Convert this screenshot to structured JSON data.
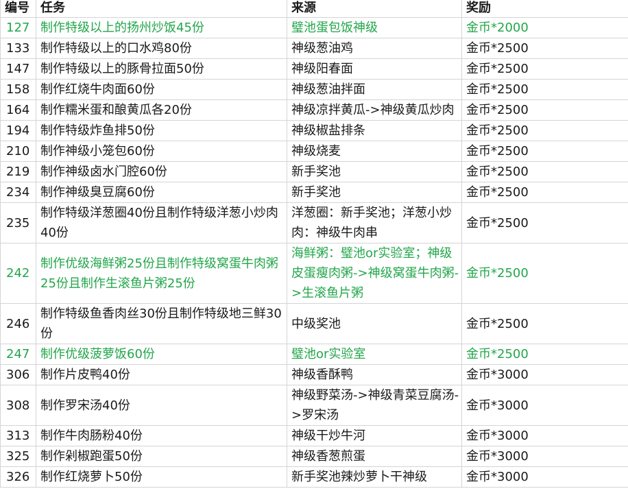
{
  "header": {
    "id": "编号",
    "task": "任务",
    "source": "来源",
    "reward": "奖励"
  },
  "rows": [
    {
      "id": "127",
      "task": "制作特级以上的扬州炒饭45份",
      "source": "璧池蛋包饭神级",
      "reward": "金币*2000",
      "highlight": true
    },
    {
      "id": "133",
      "task": "制作特级以上的口水鸡80份",
      "source": "神级葱油鸡",
      "reward": "金币*2500",
      "highlight": false
    },
    {
      "id": "147",
      "task": "制作特级以上的豚骨拉面50份",
      "source": "神级阳春面",
      "reward": "金币*2500",
      "highlight": false
    },
    {
      "id": "158",
      "task": "制作红烧牛肉面60份",
      "source": "神级葱油拌面",
      "reward": "金币*2500",
      "highlight": false
    },
    {
      "id": "164",
      "task": "制作糯米蛋和酿黄瓜各20份",
      "source": "神级凉拌黄瓜->神级黄瓜炒肉",
      "reward": "金币*2500",
      "highlight": false
    },
    {
      "id": "194",
      "task": "制作特级炸鱼排50份",
      "source": "神级椒盐排条",
      "reward": "金币*2500",
      "highlight": false
    },
    {
      "id": "210",
      "task": "制作神级小笼包60份",
      "source": "神级烧麦",
      "reward": "金币*2500",
      "highlight": false
    },
    {
      "id": "219",
      "task": "制作神级卤水门腔60份",
      "source": "新手奖池",
      "reward": "金币*2500",
      "highlight": false
    },
    {
      "id": "234",
      "task": "制作神级臭豆腐60份",
      "source": "新手奖池",
      "reward": "金币*2500",
      "highlight": false
    },
    {
      "id": "235",
      "task": "制作特级洋葱圈40份且制作特级洋葱小炒肉40份",
      "source": "洋葱圈：新手奖池；洋葱小炒肉：神级牛肉串",
      "reward": "金币*2500",
      "highlight": false
    },
    {
      "id": "242",
      "task": "制作优级海鲜粥25份且制作特级窝蛋牛肉粥25份且制作生滚鱼片粥25份",
      "source": "海鲜粥：璧池or实验室；神级皮蛋瘦肉粥->神级窝蛋牛肉粥->生滚鱼片粥",
      "reward": "金币*2500",
      "highlight": true
    },
    {
      "id": "246",
      "task": "制作特级鱼香肉丝30份且制作特级地三鲜30份",
      "source": "中级奖池",
      "reward": "金币*2500",
      "highlight": false
    },
    {
      "id": "247",
      "task": "制作优级菠萝饭60份",
      "source": "璧池or实验室",
      "reward": "金币*2500",
      "highlight": true
    },
    {
      "id": "306",
      "task": "制作片皮鸭40份",
      "source": "神级香酥鸭",
      "reward": "金币*3000",
      "highlight": false
    },
    {
      "id": "308",
      "task": "制作罗宋汤40份",
      "source": "神级野菜汤->神级青菜豆腐汤->罗宋汤",
      "reward": "金币*3000",
      "highlight": false
    },
    {
      "id": "313",
      "task": "制作牛肉肠粉40份",
      "source": "神级干炒牛河",
      "reward": "金币*3000",
      "highlight": false
    },
    {
      "id": "325",
      "task": "制作剁椒跑蛋50份",
      "source": "神级香葱煎蛋",
      "reward": "金币*3000",
      "highlight": false
    },
    {
      "id": "326",
      "task": "制作红烧萝卜50份",
      "source": "新手奖池辣炒萝卜干神级",
      "reward": "金币*3000",
      "highlight": false
    }
  ]
}
